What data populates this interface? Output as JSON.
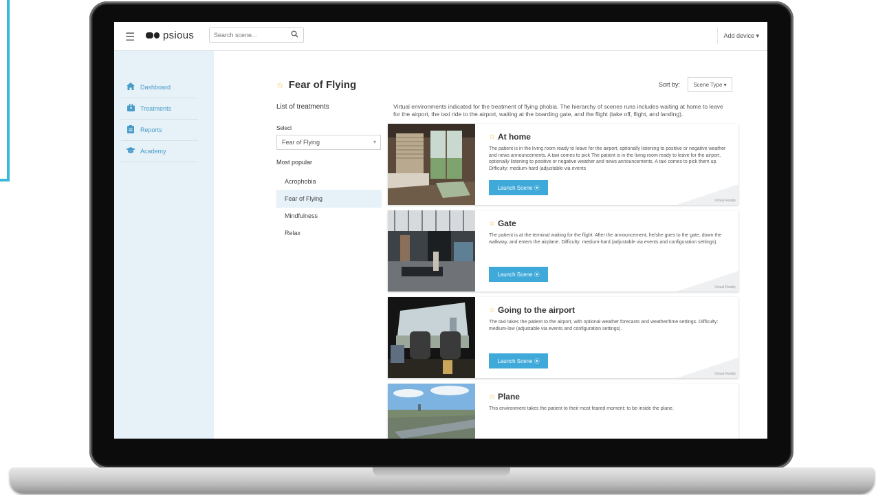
{
  "app": {
    "logo_text": "psious"
  },
  "topbar": {
    "search_placeholder": "Search scene...",
    "add_device_label": "Add device ▾"
  },
  "sidebar": {
    "items": [
      {
        "label": "Dashboard",
        "icon": "home-icon"
      },
      {
        "label": "Treatments",
        "icon": "briefcase-icon"
      },
      {
        "label": "Reports",
        "icon": "report-icon"
      },
      {
        "label": "Academy",
        "icon": "graduation-cap-icon"
      }
    ]
  },
  "main": {
    "title": "Fear of Flying",
    "sort_label": "Sort by:",
    "sort_value": "Scene Type ▾",
    "list_heading": "List of treatments",
    "select_label": "Select",
    "select_value": "Fear of Flying",
    "popular_heading": "Most popular",
    "popular": [
      "Acrophobia",
      "Fear of Flying",
      "Mindfulness",
      "Relax"
    ],
    "description": "Virtual environments indicated for the treatment of flying phobia. The hierarchy of scenes runs includes waiting at home to leave for the airport, the taxi ride to the airport, waiting at the boarding gate, and the flight (take off, flight, and landing).",
    "scenes": [
      {
        "title": "At home",
        "text": "The patient is in the living room ready to leave for the airport, optionally listening to positive or negative weather and news announcements. A taxi comes to pick The patient is in the living room ready to leave for the airport, optionally listening to positive or negative weather and news announcements. A taxi comes to pick them up. Difficulty: medium-hard (adjustable via events",
        "button": "Launch Scene ⦿",
        "tag": "Virtual Reality"
      },
      {
        "title": "Gate",
        "text": "The patient is at the terminal waiting for the flight. After the announcement, he/she goes to the gate, down the walkway, and enters the airplane. Difficulty: medium-hard (adjustable via events and configuration settings).",
        "button": "Launch Scene ⦿",
        "tag": "Virtual Reality"
      },
      {
        "title": "Going to the airport",
        "text": "The taxi takes the patient to the airport, with optional weather forecasts and weather/time settings. Difficulty: medium-low (adjustable via events and configuration settings).",
        "button": "Launch Scene ⦿",
        "tag": "Virtual Reality"
      },
      {
        "title": "Plane",
        "text": "This environment takes the patient to their most feared moment: to be inside the plane.",
        "button": "",
        "tag": ""
      }
    ]
  },
  "colors": {
    "accent": "#3fa9d9",
    "sidebar_bg": "#e6f1f8",
    "star": "#f0b429"
  }
}
